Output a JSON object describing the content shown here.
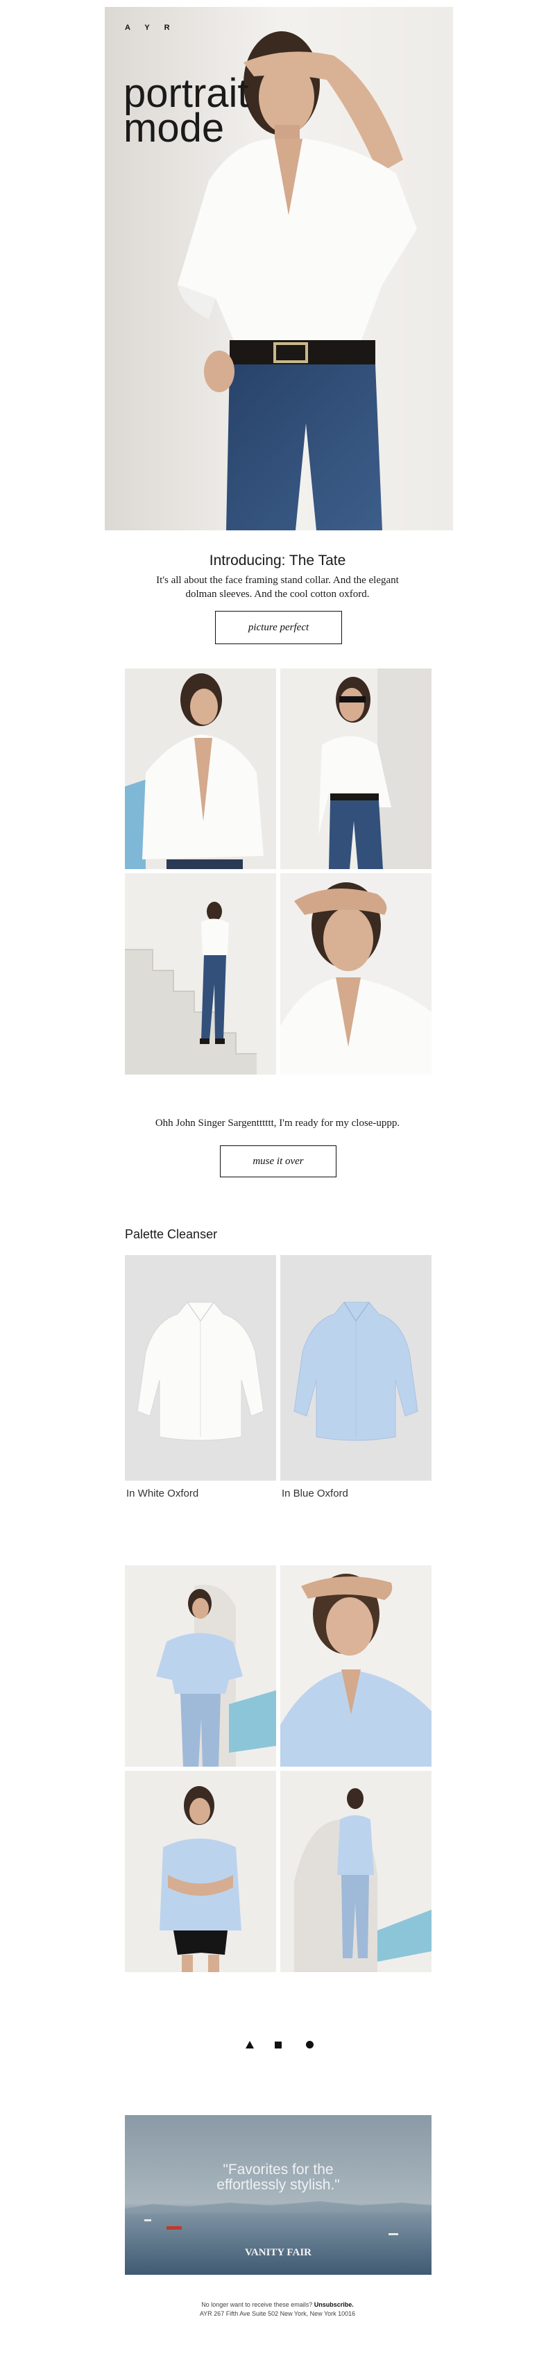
{
  "hero": {
    "brand_logo": "A Y R",
    "headline_line1": "portrait",
    "headline_line2": "mode"
  },
  "intro": {
    "title": "Introducing: The Tate",
    "body_line1": "It's all about the face framing stand collar. And the elegant",
    "body_line2": "dolman sleeves. And the cool cotton oxford.",
    "cta_label": "picture perfect"
  },
  "grid1": {
    "caption": "Ohh John Singer Sargentttttt, I'm ready for my close-uppp.",
    "cta_label": "muse it over"
  },
  "palette": {
    "title": "Palette Cleanser",
    "products": [
      {
        "label": "In White Oxford",
        "color": "#f4f4f2"
      },
      {
        "label": "In Blue Oxford",
        "color": "#bcd3ee"
      }
    ]
  },
  "shapes": {
    "icons": [
      "triangle-icon",
      "square-icon",
      "circle-icon"
    ]
  },
  "press": {
    "quote_line1": "\"Favorites for the",
    "quote_line2": "effortlessly stylish.\"",
    "publication": "VANITY FAIR"
  },
  "footer": {
    "line1_prefix": "No longer want to receive these emails? ",
    "unsubscribe_label": "Unsubscribe.",
    "line2": "AYR 267 Fifth Ave Suite 502 New York, New York 10016"
  },
  "colors": {
    "accent": "#111111",
    "background": "#ffffff",
    "photo_wall": "#ece9e4",
    "denim": "#2f4a70",
    "sky_blue_shirt": "#bcd3ee"
  }
}
